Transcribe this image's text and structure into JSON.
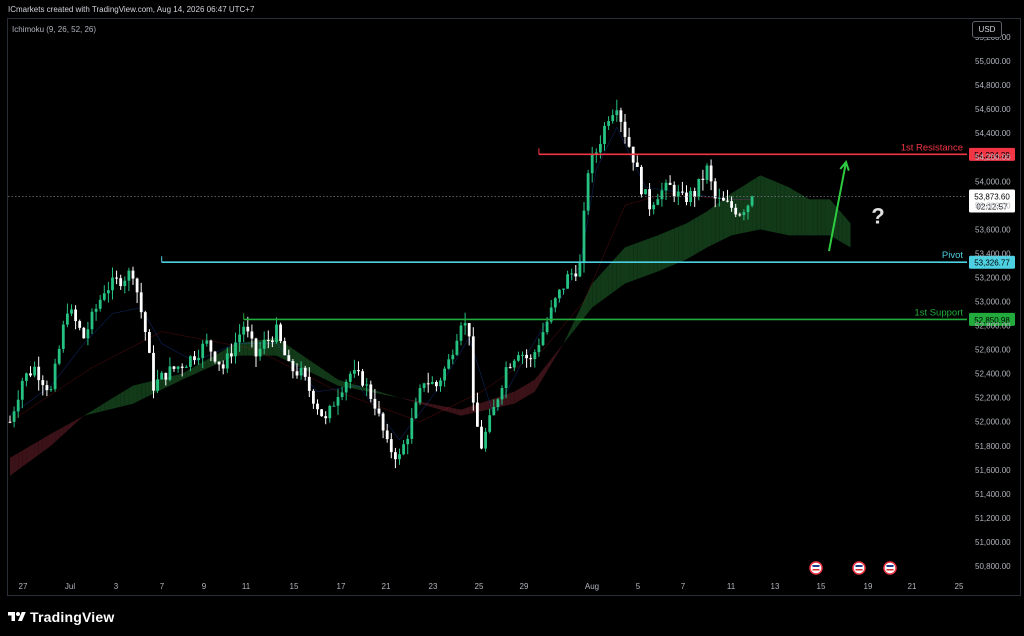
{
  "header": {
    "attribution": "ICmarkets created with TradingView.com, Aug 14, 2026 06:47 UTC+7",
    "indicator": "Ichimoku (9, 26, 52, 26)",
    "currency": "USD"
  },
  "footer": {
    "brand": "TradingView"
  },
  "colors": {
    "background": "#000000",
    "bull": "#26c281",
    "bear": "#ffffff",
    "resistance": "#f23645",
    "pivot": "#4dd0e1",
    "support": "#22ab3c",
    "cloud_bull": "#123a19",
    "cloud_bear": "#3a1218",
    "arrow": "#2ecc40"
  },
  "chart_data": {
    "type": "candlestick",
    "instrument": "ICmarkets",
    "ylim": [
      50700,
      55350
    ],
    "y_ticks": [
      "55,200.00",
      "55,000.00",
      "54,800.00",
      "54,600.00",
      "54,400.00",
      "54,200.00",
      "54,000.00",
      "53,800.00",
      "53,600.00",
      "53,400.00",
      "53,200.00",
      "53,000.00",
      "52,800.00",
      "52,600.00",
      "52,400.00",
      "52,200.00",
      "52,000.00",
      "51,800.00",
      "51,600.00",
      "51,400.00",
      "51,200.00",
      "51,000.00",
      "50,800.00"
    ],
    "x_ticks": [
      "27",
      "Jul",
      "3",
      "7",
      "9",
      "11",
      "15",
      "17",
      "21",
      "23",
      "25",
      "29",
      "Aug",
      "5",
      "7",
      "11",
      "13",
      "15",
      "19",
      "21",
      "25"
    ],
    "price_labels": {
      "resistance": "54,224.39",
      "current": "53,873.60",
      "countdown": "02:12:57",
      "pivot": "53,326.77",
      "support": "52,850.98"
    },
    "levels": [
      {
        "name": "1st Resistance",
        "value": 54224.39,
        "start": 129
      },
      {
        "name": "Pivot",
        "value": 53326.77,
        "start": 37
      },
      {
        "name": "1st Support",
        "value": 52850.98,
        "start": 57
      }
    ],
    "current_price": 53873.6,
    "annotation": "?",
    "anchors": [
      [
        0,
        52000
      ],
      [
        3,
        52350
      ],
      [
        6,
        52450
      ],
      [
        10,
        52250
      ],
      [
        14,
        52950
      ],
      [
        18,
        52700
      ],
      [
        23,
        53100
      ],
      [
        30,
        53250
      ],
      [
        33,
        52750
      ],
      [
        35,
        52300
      ],
      [
        38,
        52400
      ],
      [
        43,
        52500
      ],
      [
        48,
        52650
      ],
      [
        52,
        52450
      ],
      [
        57,
        52800
      ],
      [
        60,
        52550
      ],
      [
        62,
        52650
      ],
      [
        65,
        52750
      ],
      [
        68,
        52450
      ],
      [
        71,
        52400
      ],
      [
        74,
        52200
      ],
      [
        77,
        52000
      ],
      [
        80,
        52250
      ],
      [
        83,
        52400
      ],
      [
        86,
        52350
      ],
      [
        89,
        52150
      ],
      [
        92,
        51800
      ],
      [
        95,
        51700
      ],
      [
        98,
        52000
      ],
      [
        101,
        52350
      ],
      [
        104,
        52300
      ],
      [
        107,
        52500
      ],
      [
        110,
        52850
      ],
      [
        112,
        52750
      ],
      [
        113,
        52100
      ],
      [
        115,
        51800
      ],
      [
        118,
        52100
      ],
      [
        121,
        52450
      ],
      [
        124,
        52600
      ],
      [
        127,
        52500
      ],
      [
        130,
        52750
      ],
      [
        133,
        53000
      ],
      [
        136,
        53200
      ],
      [
        139,
        53300
      ],
      [
        141,
        54100
      ],
      [
        143,
        54250
      ],
      [
        146,
        54550
      ],
      [
        148,
        54650
      ],
      [
        150,
        54400
      ],
      [
        152,
        54200
      ],
      [
        154,
        53950
      ],
      [
        156,
        53800
      ],
      [
        158,
        53900
      ],
      [
        161,
        53950
      ],
      [
        164,
        53850
      ],
      [
        167,
        53900
      ],
      [
        170,
        54100
      ],
      [
        172,
        53850
      ],
      [
        175,
        53800
      ],
      [
        178,
        53750
      ],
      [
        181,
        53850
      ]
    ],
    "tenkan_anchors": [
      [
        0,
        52050
      ],
      [
        10,
        52300
      ],
      [
        18,
        52650
      ],
      [
        25,
        52900
      ],
      [
        32,
        52950
      ],
      [
        37,
        52650
      ],
      [
        45,
        52500
      ],
      [
        55,
        52650
      ],
      [
        65,
        52650
      ],
      [
        75,
        52250
      ],
      [
        85,
        52300
      ],
      [
        95,
        51850
      ],
      [
        105,
        52300
      ],
      [
        112,
        52700
      ],
      [
        118,
        52050
      ],
      [
        125,
        52500
      ],
      [
        133,
        52950
      ],
      [
        139,
        53300
      ],
      [
        143,
        54100
      ],
      [
        148,
        54450
      ],
      [
        155,
        53950
      ],
      [
        165,
        53900
      ],
      [
        175,
        53850
      ],
      [
        181,
        53850
      ]
    ],
    "kijun_anchors": [
      [
        0,
        52000
      ],
      [
        20,
        52450
      ],
      [
        37,
        52750
      ],
      [
        60,
        52600
      ],
      [
        80,
        52250
      ],
      [
        100,
        52000
      ],
      [
        115,
        52250
      ],
      [
        130,
        52600
      ],
      [
        140,
        53000
      ],
      [
        150,
        53800
      ],
      [
        160,
        53900
      ],
      [
        175,
        53850
      ],
      [
        181,
        53850
      ]
    ],
    "cloud_a_anchors": [
      [
        0,
        51550
      ],
      [
        10,
        51800
      ],
      [
        18,
        52050
      ],
      [
        30,
        52300
      ],
      [
        42,
        52400
      ],
      [
        55,
        52650
      ],
      [
        65,
        52700
      ],
      [
        80,
        52350
      ],
      [
        95,
        52200
      ],
      [
        110,
        52050
      ],
      [
        123,
        52150
      ],
      [
        128,
        52250
      ],
      [
        135,
        52650
      ],
      [
        142,
        53150
      ],
      [
        150,
        53450
      ],
      [
        158,
        53550
      ],
      [
        165,
        53650
      ],
      [
        170,
        53750
      ],
      [
        176,
        53900
      ],
      [
        183,
        54050
      ],
      [
        190,
        53950
      ],
      [
        195,
        53850
      ],
      [
        200,
        53850
      ],
      [
        205,
        53650
      ]
    ],
    "cloud_b_anchors": [
      [
        0,
        51700
      ],
      [
        10,
        51900
      ],
      [
        18,
        52050
      ],
      [
        30,
        52150
      ],
      [
        42,
        52350
      ],
      [
        55,
        52550
      ],
      [
        65,
        52550
      ],
      [
        80,
        52300
      ],
      [
        95,
        52200
      ],
      [
        110,
        52100
      ],
      [
        123,
        52250
      ],
      [
        128,
        52350
      ],
      [
        135,
        52650
      ],
      [
        142,
        52950
      ],
      [
        150,
        53150
      ],
      [
        158,
        53250
      ],
      [
        165,
        53350
      ],
      [
        170,
        53450
      ],
      [
        176,
        53550
      ],
      [
        183,
        53600
      ],
      [
        190,
        53550
      ],
      [
        195,
        53550
      ],
      [
        200,
        53550
      ],
      [
        205,
        53450
      ]
    ]
  }
}
